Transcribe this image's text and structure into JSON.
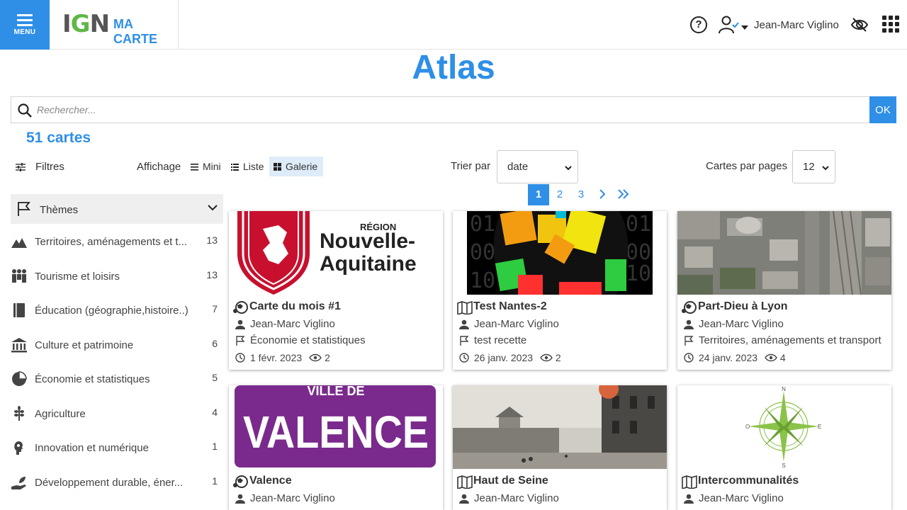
{
  "header": {
    "menu_label": "MENU",
    "logo_text_1": "I",
    "logo_text_2": "G",
    "logo_text_3": "N",
    "app_name": "MA CARTE",
    "help_symbol": "?",
    "user_name": "Jean-Marc Viglino",
    "icons": [
      "menu-icon",
      "help-icon",
      "user-check-icon",
      "caret-down-icon",
      "eye-off-icon",
      "apps-grid-icon"
    ],
    "brand_color": "#2f8fe6"
  },
  "page": {
    "title": "Atlas",
    "search_placeholder": "Rechercher...",
    "search_button": "OK",
    "count": "51 cartes"
  },
  "toolbar": {
    "filters_label": "Filtres",
    "display_label": "Affichage",
    "views": [
      {
        "label": "Mini",
        "active": false
      },
      {
        "label": "Liste",
        "active": false
      },
      {
        "label": "Galerie",
        "active": true
      }
    ],
    "sort_label": "Trier par",
    "sort_value": "date",
    "per_page_label": "Cartes par pages",
    "per_page_value": "12"
  },
  "pagination": {
    "pages": [
      "1",
      "2",
      "3"
    ],
    "current": "1",
    "next": "›",
    "last": "»"
  },
  "sidebar": {
    "header": "Thèmes",
    "items": [
      {
        "label": "Territoires, aménagements et t...",
        "count": "13",
        "icon": "terrain-icon"
      },
      {
        "label": "Tourisme et loisirs",
        "count": "13",
        "icon": "people-icon"
      },
      {
        "label": "Éducation (géographie,histoire..)",
        "count": "7",
        "icon": "book-icon"
      },
      {
        "label": "Culture et patrimoine",
        "count": "6",
        "icon": "museum-icon"
      },
      {
        "label": "Économie et statistiques",
        "count": "5",
        "icon": "pie-chart-icon"
      },
      {
        "label": "Agriculture",
        "count": "4",
        "icon": "wheat-icon"
      },
      {
        "label": "Innovation et numérique",
        "count": "1",
        "icon": "lightbulb-head-icon"
      },
      {
        "label": "Développement durable, éner...",
        "count": "1",
        "icon": "plant-hand-icon"
      }
    ]
  },
  "cards": [
    {
      "title": "Carte du mois #1",
      "author": "Jean-Marc Viglino",
      "theme": "Économie et statistiques",
      "date": "1 févr. 2023",
      "views": "2",
      "type_icon": "storymap-icon",
      "thumb_text_1": "RÉGION",
      "thumb_text_2": "Nouvelle-",
      "thumb_text_3": "Aquitaine"
    },
    {
      "title": "Test Nantes-2",
      "author": "Jean-Marc Viglino",
      "theme": "test recette",
      "date": "26 janv. 2023",
      "views": "2",
      "type_icon": "map-icon"
    },
    {
      "title": "Part-Dieu à Lyon",
      "author": "Jean-Marc Viglino",
      "theme": "Territoires, aménagements et transport",
      "date": "24 janv. 2023",
      "views": "4",
      "type_icon": "storymap-icon"
    },
    {
      "title": "Valence",
      "author": "Jean-Marc Viglino",
      "type_icon": "storymap-icon",
      "thumb_text_1": "VILLE DE",
      "thumb_text_2": "VALENCE"
    },
    {
      "title": "Haut de Seine",
      "author": "Jean-Marc Viglino",
      "type_icon": "map-icon"
    },
    {
      "title": "Intercommunalités",
      "author": "Jean-Marc Viglino",
      "type_icon": "map-icon",
      "thumb_text_1": "N",
      "thumb_text_2": "S",
      "thumb_text_3": "E",
      "thumb_text_4": "O"
    }
  ]
}
